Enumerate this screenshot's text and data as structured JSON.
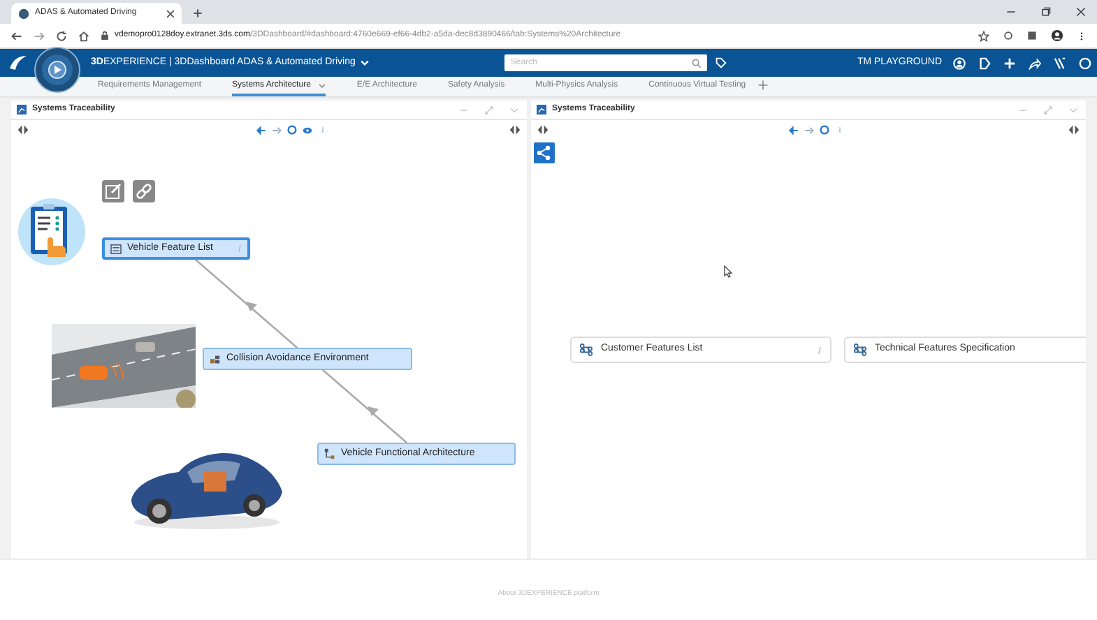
{
  "browser": {
    "tab_title": "ADAS & Automated Driving",
    "url_host": "vdemopro0128doy.extranet.3ds.com",
    "url_path": "/3DDashboard/#dashboard:4760e669-ef66-4db2-a5da-dec8d3890466/tab:Systems%20Architecture"
  },
  "header": {
    "brand": "**3D**EXPERIENCE | 3DDashboard",
    "dashboard": "ADAS & Automated Driving",
    "search": {
      "placeholder": "Search"
    },
    "workspace": "TM PLAYGROUND"
  },
  "tabs": [
    {
      "label": "Requirements Management",
      "selected": false
    },
    {
      "label": "Systems Architecture",
      "selected": true
    },
    {
      "label": "E/E Architecture",
      "selected": false
    },
    {
      "label": "Safety Analysis",
      "selected": false
    },
    {
      "label": "Multi-Physics Analysis",
      "selected": false
    },
    {
      "label": "Continuous Virtual Testing",
      "selected": false
    }
  ],
  "panels": [
    {
      "title": "Systems Traceability",
      "nodes": [
        {
          "label": "Vehicle Feature List",
          "kind": "list",
          "selected": true
        },
        {
          "label": "Collision Avoidance Environment",
          "kind": "environment",
          "selected": false
        },
        {
          "label": "Vehicle Functional Architecture",
          "kind": "architecture",
          "selected": false
        }
      ]
    },
    {
      "title": "Systems Traceability",
      "nodes": [
        {
          "label": "Customer Features List",
          "kind": "feature",
          "selected": false
        },
        {
          "label": "Technical Features Specification",
          "kind": "feature",
          "selected": false
        }
      ]
    }
  ],
  "footer": "About 3DEXPERIENCE platform"
}
